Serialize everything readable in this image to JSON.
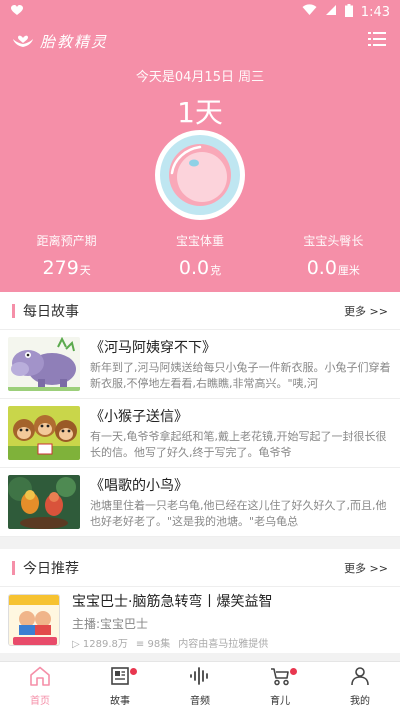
{
  "status_bar": {
    "time": "1:43"
  },
  "app": {
    "name": "胎教精灵"
  },
  "hero": {
    "date_text": "今天是04月15日 周三",
    "days": "1天",
    "stats": [
      {
        "label": "距离预产期",
        "value": "279",
        "unit": "天"
      },
      {
        "label": "宝宝体重",
        "value": "0.0",
        "unit": "克"
      },
      {
        "label": "宝宝头臀长",
        "value": "0.0",
        "unit": "厘米"
      }
    ]
  },
  "daily_story": {
    "title": "每日故事",
    "more": "更多 >>",
    "items": [
      {
        "title": "《河马阿姨穿不下》",
        "desc": "新年到了,河马阿姨送给每只小兔子一件新衣服。小兔子们穿着新衣服,不停地左看看,右瞧瞧,非常高兴。\"咦,河",
        "thumb": "hippo"
      },
      {
        "title": "《小猴子送信》",
        "desc": "有一天,龟爷爷拿起纸和笔,戴上老花镜,开始写起了一封很长很长的信。他写了好久,终于写完了。龟爷爷",
        "thumb": "monkeys"
      },
      {
        "title": "《唱歌的小鸟》",
        "desc": "池塘里住着一只老乌龟,他已经在这儿住了好久好久了,而且,他也好老好老了。\"这是我的池塘。\"老乌龟总",
        "thumb": "birds"
      }
    ]
  },
  "today_rec": {
    "title": "今日推荐",
    "more": "更多 >>",
    "item": {
      "title": "宝宝巴士·脑筋急转弯丨爆笑益智",
      "host": "主播:宝宝巴士",
      "plays": "1289.8万",
      "episodes": "98集",
      "source": "内容由喜马拉雅提供"
    }
  },
  "tabs": [
    {
      "label": "首页",
      "icon": "home-icon",
      "active": true,
      "dot": false
    },
    {
      "label": "故事",
      "icon": "book-icon",
      "active": false,
      "dot": true
    },
    {
      "label": "音频",
      "icon": "audio-icon",
      "active": false,
      "dot": false
    },
    {
      "label": "育儿",
      "icon": "stroller-icon",
      "active": false,
      "dot": true
    },
    {
      "label": "我的",
      "icon": "person-icon",
      "active": false,
      "dot": false
    }
  ],
  "colors": {
    "brand": "#f58fa8",
    "badge": "#e8374f"
  }
}
